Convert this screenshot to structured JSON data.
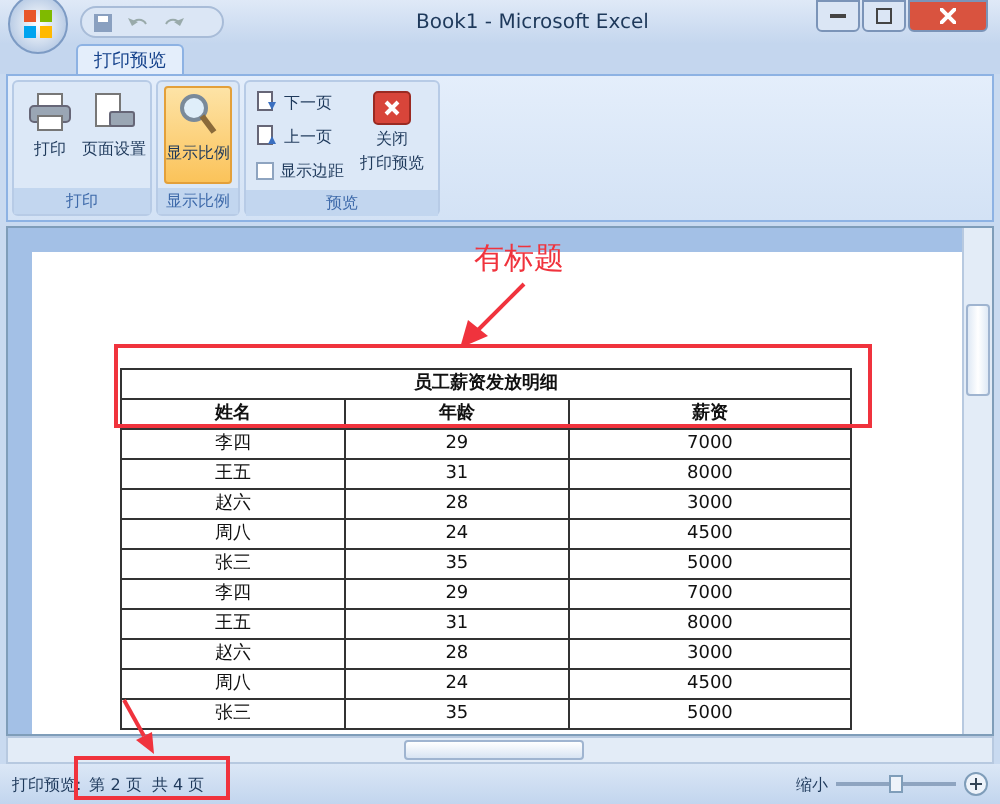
{
  "window": {
    "title": "Book1 - Microsoft Excel"
  },
  "tabs": [
    {
      "label": "打印预览",
      "selected": true
    }
  ],
  "ribbon": {
    "groups": [
      {
        "label": "打印",
        "items": [
          {
            "kind": "large",
            "label": "打印",
            "selected": false
          },
          {
            "kind": "large",
            "label": "页面设置",
            "selected": false
          }
        ]
      },
      {
        "label": "显示比例",
        "items": [
          {
            "kind": "large",
            "label": "显示比例",
            "selected": true
          }
        ]
      },
      {
        "label": "预览",
        "items": [
          {
            "kind": "small",
            "label": "下一页",
            "disabled": false
          },
          {
            "kind": "small",
            "label": "上一页",
            "disabled": false
          },
          {
            "kind": "check",
            "label": "显示边距",
            "checked": false
          },
          {
            "kind": "close",
            "lines": [
              "关闭",
              "打印预览"
            ]
          }
        ]
      }
    ]
  },
  "sheet": {
    "title": "员工薪资发放明细",
    "columns": [
      "姓名",
      "年龄",
      "薪资"
    ],
    "rows": [
      [
        "李四",
        "29",
        "7000"
      ],
      [
        "王五",
        "31",
        "8000"
      ],
      [
        "赵六",
        "28",
        "3000"
      ],
      [
        "周八",
        "24",
        "4500"
      ],
      [
        "张三",
        "35",
        "5000"
      ],
      [
        "李四",
        "29",
        "7000"
      ],
      [
        "王五",
        "31",
        "8000"
      ],
      [
        "赵六",
        "28",
        "3000"
      ],
      [
        "周八",
        "24",
        "4500"
      ],
      [
        "张三",
        "35",
        "5000"
      ]
    ]
  },
  "annotations": [
    {
      "kind": "title-callout",
      "label": "有标题"
    },
    {
      "kind": "status-callout"
    }
  ],
  "status_bar": {
    "mode": "打印预览:",
    "page": "第 2 页  共 4 页",
    "zoom_out": "缩小",
    "zoom_slider": {
      "level": 0.5
    }
  }
}
